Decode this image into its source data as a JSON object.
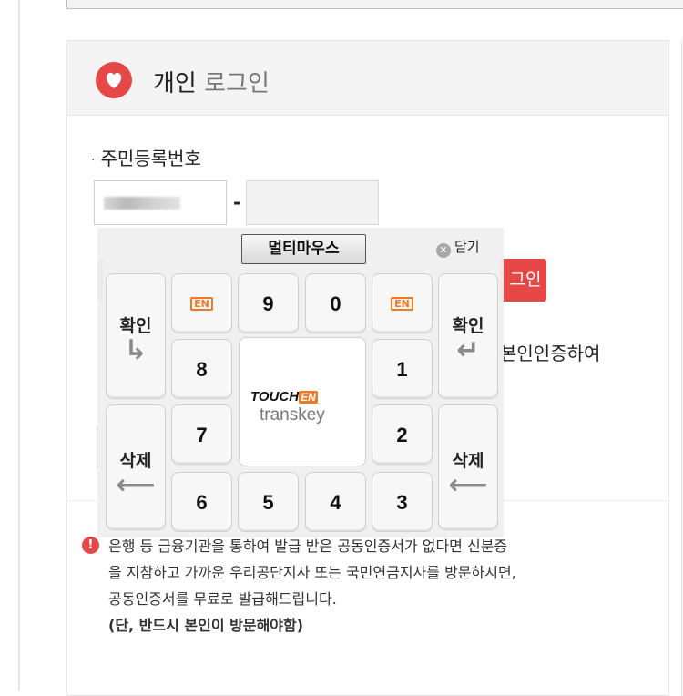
{
  "panel": {
    "title_strong": "개인",
    "title_light": "로그인"
  },
  "form": {
    "field_label": "주민등록번호",
    "hyphen": "-",
    "login_label": "그인",
    "auth_text": "본인인증하여"
  },
  "notice": {
    "line1": "은행 등 금융기관을 통하여 발급 받은 공동인증서가 없다면 신분증",
    "line2": "을 지참하고 가까운 우리공단지사 또는 국민연금지사를 방문하시면,",
    "line3": "공동인증서를 무료로 발급해드립니다.",
    "line4": "(단, 반드시 본인이 방문해야함)"
  },
  "keypad": {
    "multimouse_label": "멀티마우스",
    "close_label": "닫기",
    "en_label": "EN",
    "confirm_label": "확인",
    "delete_label": "삭제",
    "keys": {
      "k9": "9",
      "k0": "0",
      "k8": "8",
      "k1": "1",
      "k7": "7",
      "k2": "2",
      "k6": "6",
      "k5": "5",
      "k4": "4",
      "k3": "3"
    },
    "logo_touch": "TOUCH",
    "logo_en": "EN",
    "logo_transkey": "transkey"
  },
  "colors": {
    "accent_red": "#e64747",
    "en_orange": "#f07a22"
  },
  "icons": [
    "heart-logo-icon",
    "alert-icon",
    "close-icon",
    "enter-arrow-icon",
    "backspace-arrow-icon"
  ]
}
